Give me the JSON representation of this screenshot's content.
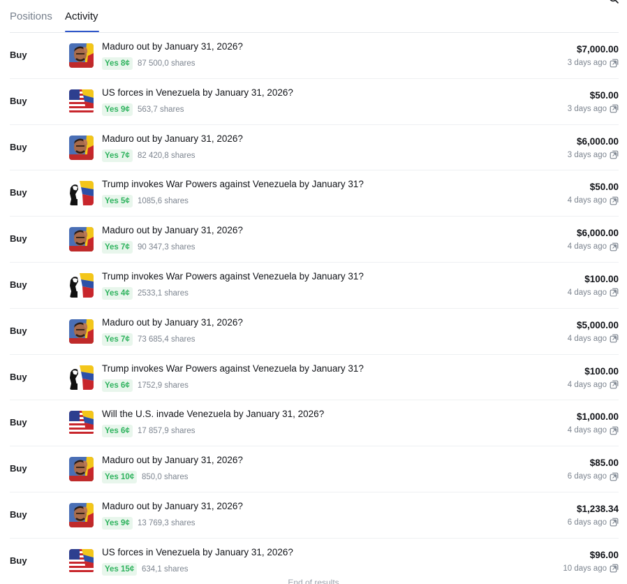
{
  "tabs": {
    "positions": "Positions",
    "activity": "Activity",
    "active": "activity"
  },
  "colors": {
    "accent": "#2d55c9",
    "yes_text": "#2fb35e",
    "yes_bg": "#e8f6ec",
    "muted": "#7d8590"
  },
  "activity": [
    {
      "type": "Buy",
      "image": "maduro",
      "title": "Maduro out by January 31, 2026?",
      "outcome": "Yes 8¢",
      "shares": "87 500,0 shares",
      "amount": "$7,000.00",
      "time": "3 days ago"
    },
    {
      "type": "Buy",
      "image": "us-venezuela-flags",
      "title": "US forces in Venezuela by January 31, 2026?",
      "outcome": "Yes 9¢",
      "shares": "563,7 shares",
      "amount": "$50.00",
      "time": "3 days ago"
    },
    {
      "type": "Buy",
      "image": "maduro",
      "title": "Maduro out by January 31, 2026?",
      "outcome": "Yes 7¢",
      "shares": "82 420,8 shares",
      "amount": "$6,000.00",
      "time": "3 days ago"
    },
    {
      "type": "Buy",
      "image": "trump-venezuela",
      "title": "Trump invokes War Powers against Venezuela by January 31?",
      "outcome": "Yes 5¢",
      "shares": "1085,6 shares",
      "amount": "$50.00",
      "time": "4 days ago"
    },
    {
      "type": "Buy",
      "image": "maduro",
      "title": "Maduro out by January 31, 2026?",
      "outcome": "Yes 7¢",
      "shares": "90 347,3 shares",
      "amount": "$6,000.00",
      "time": "4 days ago"
    },
    {
      "type": "Buy",
      "image": "trump-venezuela",
      "title": "Trump invokes War Powers against Venezuela by January 31?",
      "outcome": "Yes 4¢",
      "shares": "2533,1 shares",
      "amount": "$100.00",
      "time": "4 days ago"
    },
    {
      "type": "Buy",
      "image": "maduro",
      "title": "Maduro out by January 31, 2026?",
      "outcome": "Yes 7¢",
      "shares": "73 685,4 shares",
      "amount": "$5,000.00",
      "time": "4 days ago"
    },
    {
      "type": "Buy",
      "image": "trump-venezuela",
      "title": "Trump invokes War Powers against Venezuela by January 31?",
      "outcome": "Yes 6¢",
      "shares": "1752,9 shares",
      "amount": "$100.00",
      "time": "4 days ago"
    },
    {
      "type": "Buy",
      "image": "us-venezuela-flags",
      "title": "Will the U.S. invade Venezuela by January 31, 2026?",
      "outcome": "Yes 6¢",
      "shares": "17 857,9 shares",
      "amount": "$1,000.00",
      "time": "4 days ago"
    },
    {
      "type": "Buy",
      "image": "maduro",
      "title": "Maduro out by January 31, 2026?",
      "outcome": "Yes 10¢",
      "shares": "850,0 shares",
      "amount": "$85.00",
      "time": "6 days ago"
    },
    {
      "type": "Buy",
      "image": "maduro",
      "title": "Maduro out by January 31, 2026?",
      "outcome": "Yes 9¢",
      "shares": "13 769,3 shares",
      "amount": "$1,238.34",
      "time": "6 days ago"
    },
    {
      "type": "Buy",
      "image": "us-venezuela-flags",
      "title": "US forces in Venezuela by January 31, 2026?",
      "outcome": "Yes 15¢",
      "shares": "634,1 shares",
      "amount": "$96.00",
      "time": "10 days ago"
    }
  ],
  "footer": {
    "end_text": "End of results"
  }
}
